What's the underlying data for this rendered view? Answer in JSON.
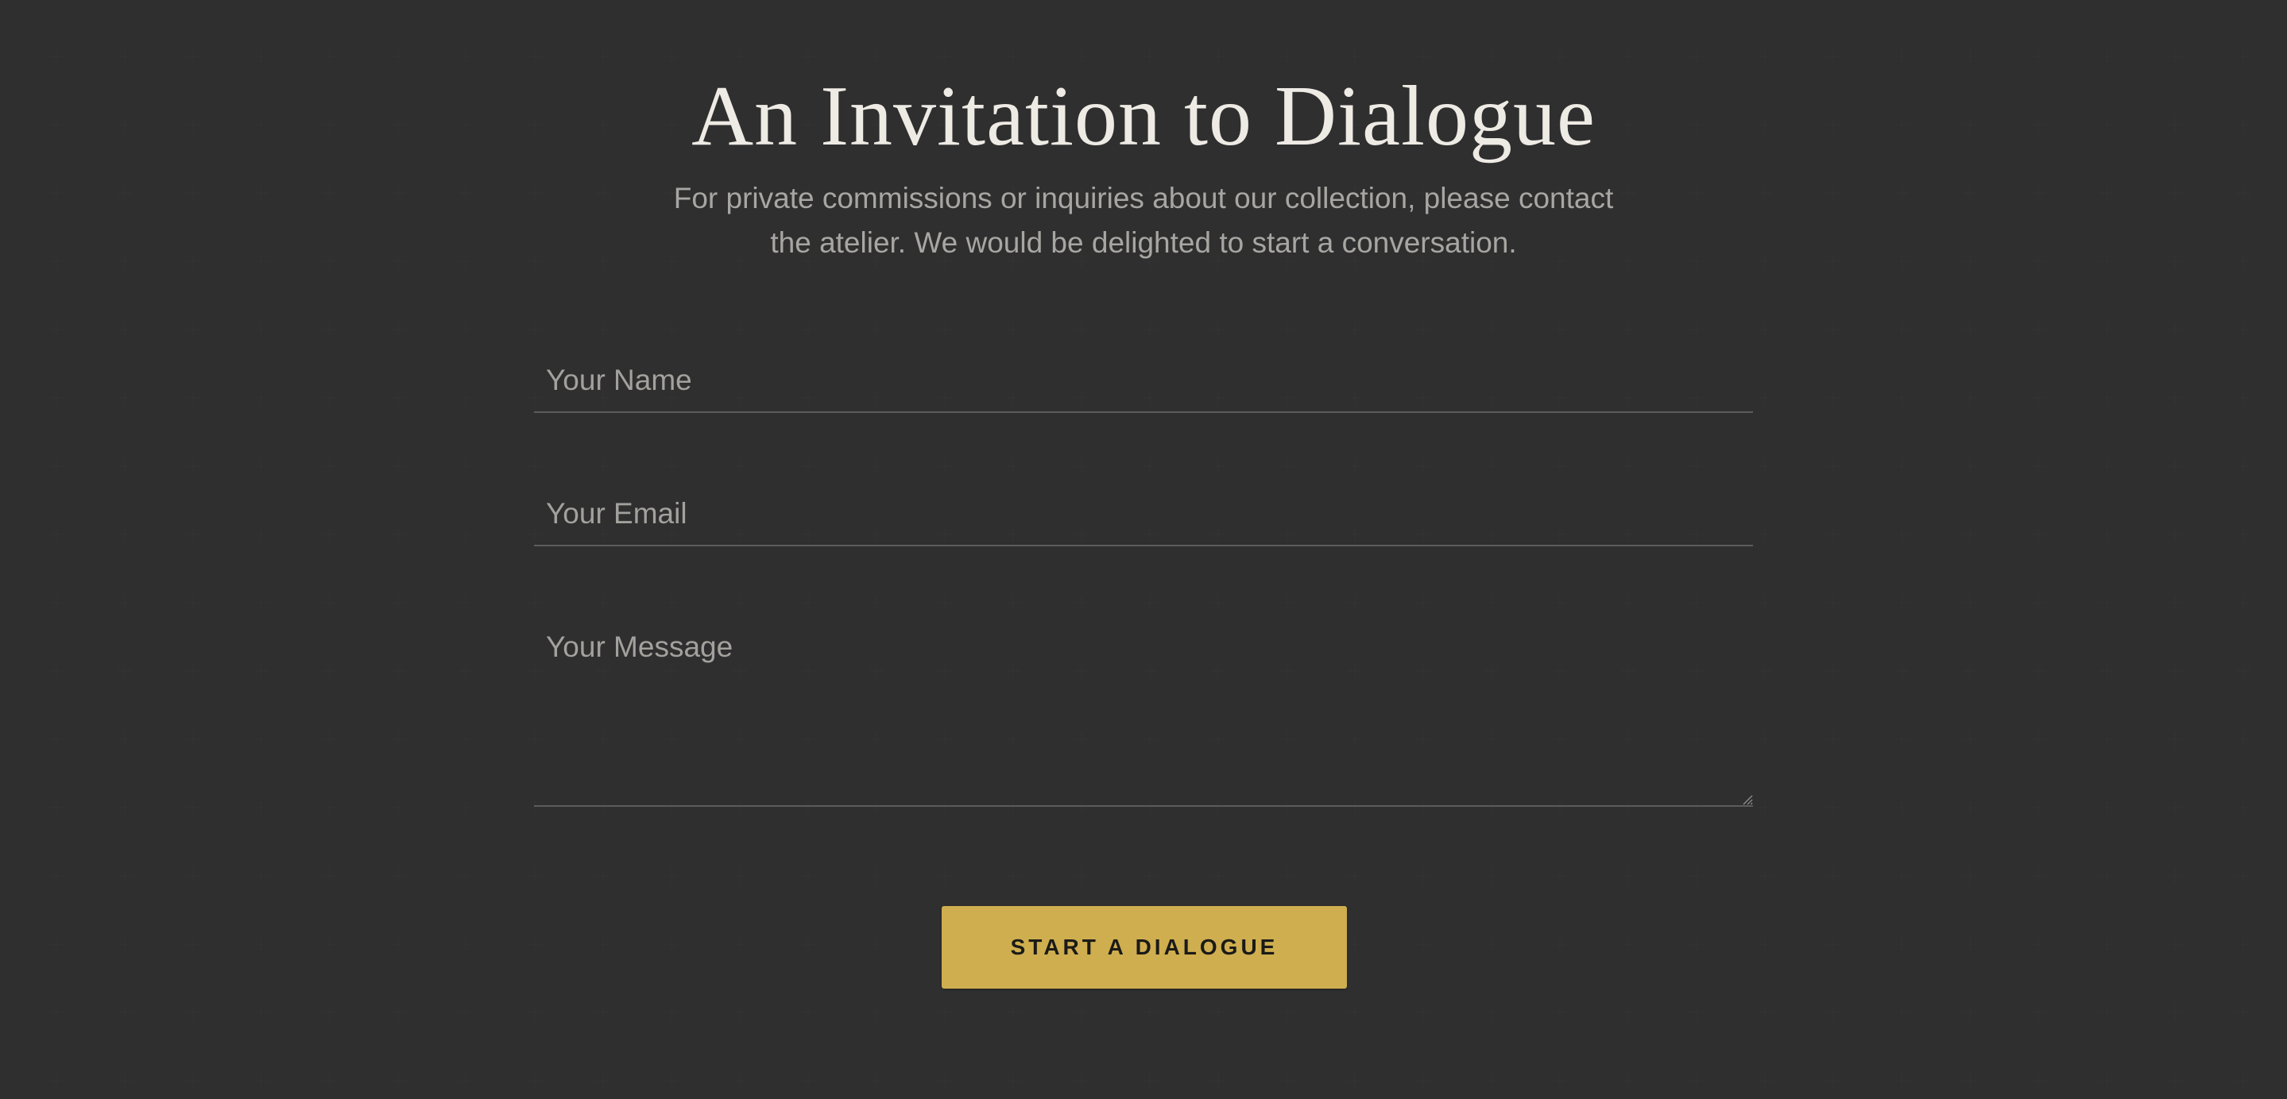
{
  "colors": {
    "background": "#292929",
    "accent": "#cfae4f",
    "title": "#eeeae4",
    "text_muted": "#a8a6a3",
    "field_border": "#5c5c5c"
  },
  "section": {
    "title": "An Invitation to Dialogue",
    "subtitle": "For private commissions or inquiries about our collection, please contact the atelier. We would be delighted to start a conversation."
  },
  "form": {
    "name_placeholder": "Your Name",
    "name_value": "",
    "email_placeholder": "Your Email",
    "email_value": "",
    "message_placeholder": "Your Message",
    "message_value": "",
    "submit_label": "Start a Dialogue"
  },
  "icons": {
    "resize_handle": "textarea-resize-icon"
  }
}
